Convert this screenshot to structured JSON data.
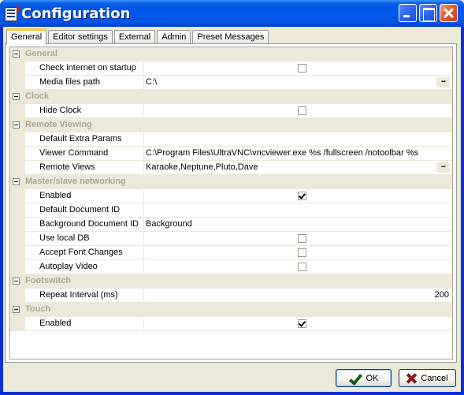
{
  "window": {
    "title": "Configuration",
    "controls": {
      "minimize": "minimize-icon",
      "maximize": "maximize-icon",
      "close": "close-icon"
    }
  },
  "tabs": [
    {
      "label": "General",
      "active": true
    },
    {
      "label": "Editor settings",
      "active": false
    },
    {
      "label": "External",
      "active": false
    },
    {
      "label": "Admin",
      "active": false
    },
    {
      "label": "Preset Messages",
      "active": false
    }
  ],
  "property_grid": {
    "categories": [
      {
        "name": "General",
        "expanded": true,
        "properties": [
          {
            "name": "Check internet on startup",
            "type": "checkbox",
            "checked": false
          },
          {
            "name": "Media files path",
            "type": "text",
            "value": "C:\\",
            "has_ellipsis": true
          }
        ]
      },
      {
        "name": "Clock",
        "expanded": true,
        "properties": [
          {
            "name": "Hide Clock",
            "type": "checkbox",
            "checked": false
          }
        ]
      },
      {
        "name": "Remote Viewing",
        "expanded": true,
        "properties": [
          {
            "name": "Default Extra Params",
            "type": "text",
            "value": ""
          },
          {
            "name": "Viewer Command",
            "type": "text",
            "value": "C:\\Program Files\\UltraVNC\\vncviewer.exe %s /fullscreen /notoolbar %s"
          },
          {
            "name": "Remote Views",
            "type": "text",
            "value": "Karaoke,Neptune,Pluto,Dave",
            "has_ellipsis": true
          }
        ]
      },
      {
        "name": "Master/slave networking",
        "expanded": true,
        "properties": [
          {
            "name": "Enabled",
            "type": "checkbox",
            "checked": true
          },
          {
            "name": "Default Document ID",
            "type": "text",
            "value": ""
          },
          {
            "name": "Background Document ID",
            "type": "text",
            "value": "Background"
          },
          {
            "name": "Use local DB",
            "type": "checkbox",
            "checked": false
          },
          {
            "name": "Accept Font Changes",
            "type": "checkbox",
            "checked": false
          },
          {
            "name": "Autoplay Video",
            "type": "checkbox",
            "checked": false
          }
        ]
      },
      {
        "name": "Footswitch",
        "expanded": true,
        "properties": [
          {
            "name": "Repeat Interval (ms)",
            "type": "number",
            "value": "200"
          }
        ]
      },
      {
        "name": "Touch",
        "expanded": true,
        "properties": [
          {
            "name": "Enabled",
            "type": "checkbox",
            "checked": true
          }
        ]
      }
    ],
    "ellipsis_label": "..."
  },
  "buttons": {
    "ok": {
      "label": "OK",
      "icon": "checkmark-icon"
    },
    "cancel": {
      "label": "Cancel",
      "icon": "x-icon"
    }
  }
}
